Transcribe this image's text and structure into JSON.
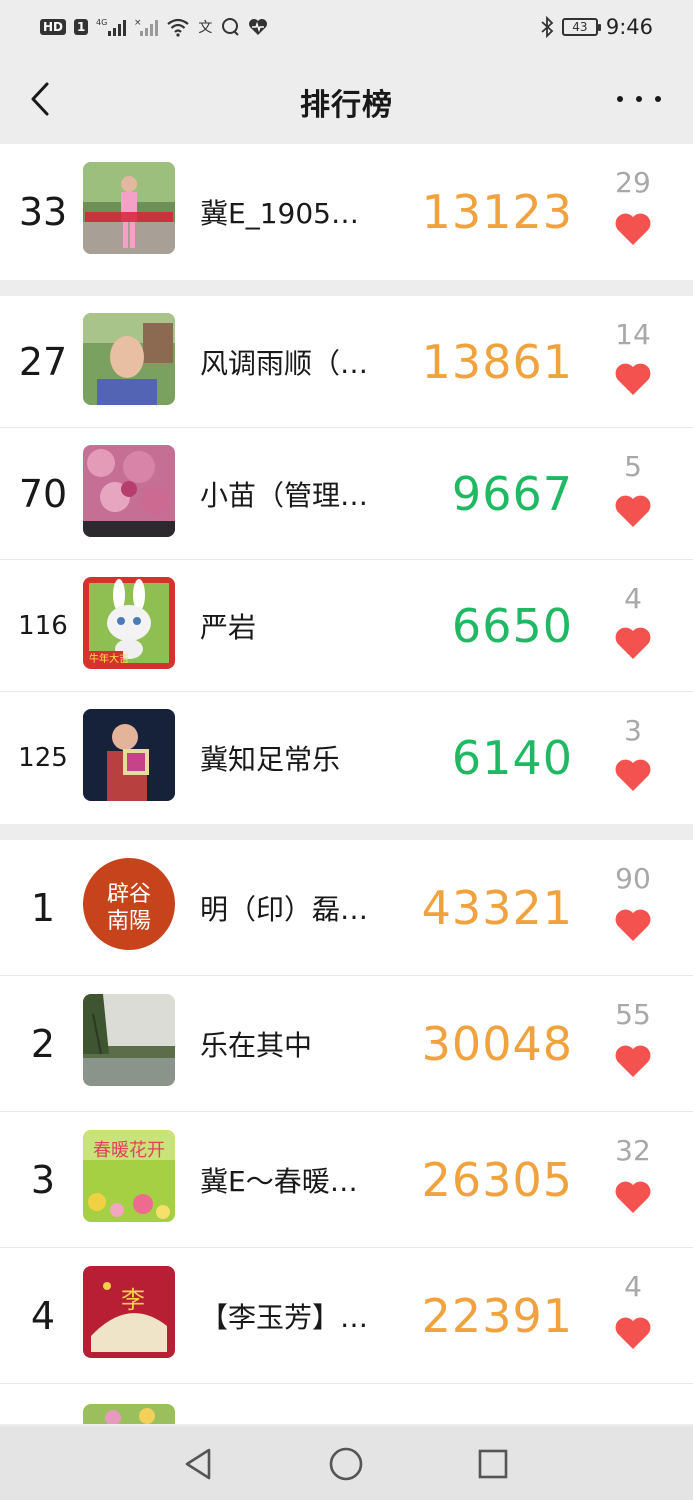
{
  "status_bar": {
    "left_badge": "HD",
    "left_badge2": "1",
    "network": "4G",
    "battery": "43",
    "time": "9:46"
  },
  "nav": {
    "title": "排行榜"
  },
  "colors": {
    "orange": "#f0a23e",
    "green": "#20b863",
    "heart": "#f4524f",
    "likes_gray": "#a8a8a8"
  },
  "sections": [
    {
      "rows": [
        {
          "rank": "33",
          "name": "冀E_1905…",
          "steps": "13123",
          "color": "orange",
          "likes": "29",
          "avatar": "photo-person-park"
        }
      ]
    },
    {
      "rows": [
        {
          "rank": "27",
          "name": "风调雨顺（…",
          "steps": "13861",
          "color": "orange",
          "likes": "14",
          "avatar": "photo-elderly-man"
        },
        {
          "rank": "70",
          "name": "小苗（管理…",
          "steps": "9667",
          "color": "green",
          "likes": "5",
          "avatar": "photo-roses"
        },
        {
          "rank": "116",
          "name": "严岩",
          "steps": "6650",
          "color": "green",
          "likes": "4",
          "avatar": "photo-rabbit-cartoon",
          "avatar_text": "牛年大吉"
        },
        {
          "rank": "125",
          "name": "冀知足常乐",
          "steps": "6140",
          "color": "green",
          "likes": "3",
          "avatar": "photo-child"
        }
      ]
    },
    {
      "rows": [
        {
          "rank": "1",
          "name": "明（印）磊…",
          "steps": "43321",
          "color": "orange",
          "likes": "90",
          "avatar": "seal-logo",
          "avatar_text": "辟谷南陽"
        },
        {
          "rank": "2",
          "name": "乐在其中",
          "steps": "30048",
          "color": "orange",
          "likes": "55",
          "avatar": "photo-lake"
        },
        {
          "rank": "3",
          "name": "冀E～春暖…",
          "steps": "26305",
          "color": "orange",
          "likes": "32",
          "avatar": "photo-spring-flowers",
          "avatar_text": "春暖花开"
        },
        {
          "rank": "4",
          "name": "【李玉芳】…",
          "steps": "22391",
          "color": "orange",
          "likes": "4",
          "avatar": "photo-red-card",
          "avatar_text": "李"
        }
      ]
    }
  ],
  "system_nav": [
    "back-triangle-icon",
    "home-circle-icon",
    "recents-square-icon"
  ]
}
